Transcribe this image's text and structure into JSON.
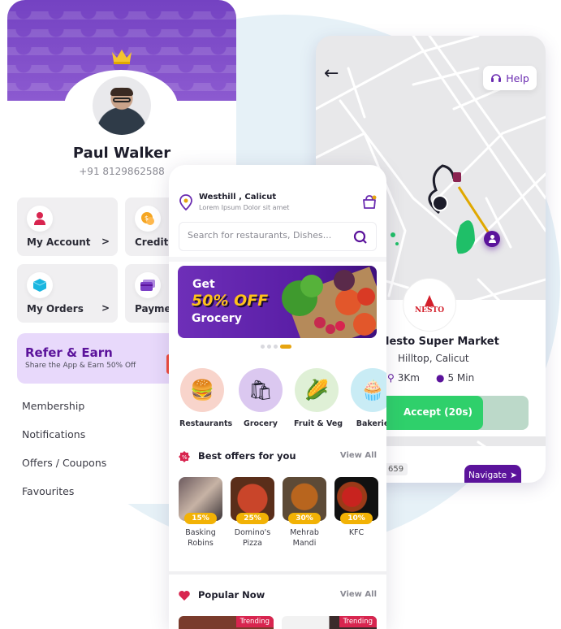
{
  "profile": {
    "name": "Paul Walker",
    "phone": "+91 8129862588",
    "tiles": [
      {
        "label": "My Account",
        "icon": "user-icon",
        "color": "#d8254f"
      },
      {
        "label": "Credit p",
        "icon": "coin-icon",
        "color": "#f5a623"
      },
      {
        "label": "My Orders",
        "icon": "box-icon",
        "color": "#1ab6e0"
      },
      {
        "label": "Paymer",
        "icon": "card-icon",
        "color": "#7b3fc6"
      }
    ],
    "tile_chevron": ">",
    "refer": {
      "title": "Refer & Earn",
      "subtitle": "Share the App & Earn 50% Off"
    },
    "menu": [
      "Membership",
      "Notifications",
      "Offers / Coupons",
      "Favourites"
    ]
  },
  "home": {
    "location": {
      "title": "Westhill , Calicut",
      "subtitle": "Lorem Ipsum Dolor sit amet"
    },
    "search": {
      "placeholder": "Search for restaurants, Dishes..."
    },
    "banner": {
      "line1": "Get",
      "line2": "50% OFF",
      "line3": "Grocery"
    },
    "carousel": {
      "count": 4,
      "active": 3
    },
    "categories": [
      {
        "name": "Restaurants",
        "emoji": "🍔",
        "bg": "#f8d4cb"
      },
      {
        "name": "Grocery",
        "emoji": "🛍",
        "bg": "#dbc8f0"
      },
      {
        "name": "Fruit & Veg",
        "emoji": "🌽",
        "bg": "#dff0d6"
      },
      {
        "name": "Bakerie",
        "emoji": "🧁",
        "bg": "#c9ecf5"
      }
    ],
    "best_offers": {
      "title": "Best offers for you",
      "view_all": "View All",
      "items": [
        {
          "name_line1": "Basking",
          "name_line2": "Robins",
          "discount": "15%"
        },
        {
          "name_line1": "Domino's",
          "name_line2": "Pizza",
          "discount": "25%"
        },
        {
          "name_line1": "Mehrab",
          "name_line2": "Mandi",
          "discount": "30%"
        },
        {
          "name_line1": "KFC",
          "name_line2": "",
          "discount": "10%"
        }
      ]
    },
    "popular": {
      "title": "Popular Now",
      "view_all": "View All",
      "cards": [
        {
          "tag": "Trending"
        },
        {
          "tag": "Trending"
        }
      ]
    }
  },
  "map": {
    "back": "←",
    "help_label": "Help",
    "store": {
      "logo_text": "NESTO",
      "name": "lesto Super Market",
      "location": "Hilltop, Calicut",
      "distance": "3Km",
      "time": "5 Min"
    },
    "accept": {
      "label": "Accept (20s)",
      "progress_percent": 69
    },
    "next_order": {
      "code": "659",
      "navigate_label": "Navigate"
    }
  },
  "colors": {
    "brand_purple": "#5b139b",
    "accent_yellow": "#f2b205",
    "accept_green": "#2fd06b"
  }
}
